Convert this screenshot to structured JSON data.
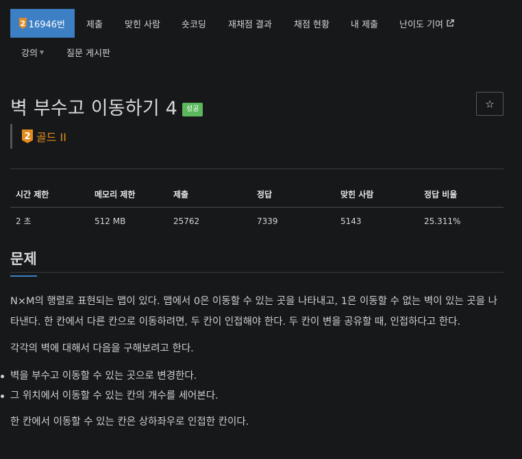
{
  "nav": {
    "problem_number": "16946번",
    "tier_digit": "2",
    "tabs": [
      "제출",
      "맞힌 사람",
      "숏코딩",
      "재채점 결과",
      "채점 현황",
      "내 제출",
      "난이도 기여"
    ],
    "row2": [
      "강의",
      "질문 게시판"
    ]
  },
  "problem": {
    "title": "벽 부수고 이동하기 4",
    "status": "성공",
    "star": "☆",
    "tier_digit": "2",
    "tier_label": "골드 II"
  },
  "stats": {
    "headers": [
      "시간 제한",
      "메모리 제한",
      "제출",
      "정답",
      "맞힌 사람",
      "정답 비율"
    ],
    "values": [
      "2 초",
      "512 MB",
      "25762",
      "7339",
      "5143",
      "25.311%"
    ]
  },
  "section": {
    "title": "문제",
    "p1": "N×M의 행렬로 표현되는 맵이 있다. 맵에서 0은 이동할 수 있는 곳을 나타내고, 1은 이동할 수 없는 벽이 있는 곳을 나타낸다. 한 칸에서 다른 칸으로 이동하려면, 두 칸이 인접해야 한다. 두 칸이 변을 공유할 때, 인접하다고 한다.",
    "p2": "각각의 벽에 대해서 다음을 구해보려고 한다.",
    "bullets": [
      "벽을 부수고 이동할 수 있는 곳으로 변경한다.",
      "그 위치에서 이동할 수 있는 칸의 개수를 세어본다."
    ],
    "p3": "한 칸에서 이동할 수 있는 칸은 상하좌우로 인접한 칸이다."
  },
  "colors": {
    "accent": "#3c7fc4",
    "gold": "#e38b1e",
    "success": "#5cb85c",
    "background": "#17181a"
  }
}
